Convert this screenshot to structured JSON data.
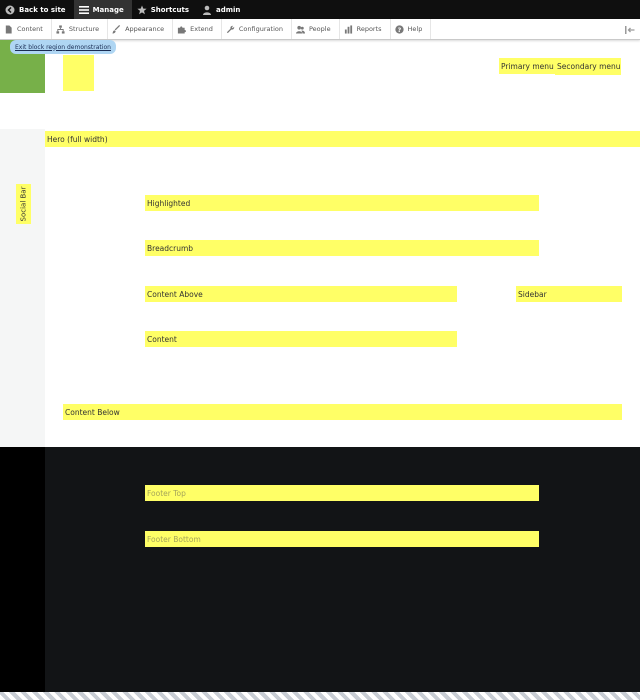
{
  "toolbar": {
    "items": [
      {
        "label": "Back to site",
        "icon": "back-arrow-icon"
      },
      {
        "label": "Manage",
        "icon": "hamburger-icon"
      },
      {
        "label": "Shortcuts",
        "icon": "star-icon"
      },
      {
        "label": "admin",
        "icon": "user-icon"
      }
    ]
  },
  "tray": {
    "items": [
      {
        "label": "Content",
        "icon": "document-icon"
      },
      {
        "label": "Structure",
        "icon": "sitemap-icon"
      },
      {
        "label": "Appearance",
        "icon": "paintbrush-icon"
      },
      {
        "label": "Extend",
        "icon": "puzzle-icon"
      },
      {
        "label": "Configuration",
        "icon": "wrench-icon"
      },
      {
        "label": "People",
        "icon": "people-icon"
      },
      {
        "label": "Reports",
        "icon": "chart-icon"
      },
      {
        "label": "Help",
        "icon": "help-icon"
      }
    ],
    "toggle_icon": "orientation-toggle-icon"
  },
  "header": {
    "exit_link": "Exit block region demonstration",
    "primary_menu": "Primary menu",
    "secondary_menu": "Secondary menu"
  },
  "regions": {
    "hero": "Hero (full width)",
    "social_bar": "Social Bar",
    "highlighted": "Highlighted",
    "breadcrumb": "Breadcrumb",
    "content_above": "Content Above",
    "sidebar": "Sidebar",
    "content": "Content",
    "content_below": "Content Below",
    "footer_top": "Footer Top",
    "footer_bottom": "Footer Bottom"
  },
  "colors": {
    "region_highlight": "#ffff66",
    "logo_green": "#77b049",
    "toolbar_black": "#0f0f0f",
    "footer_dark": "#121416",
    "exit_link_bg": "#afd6f3"
  }
}
